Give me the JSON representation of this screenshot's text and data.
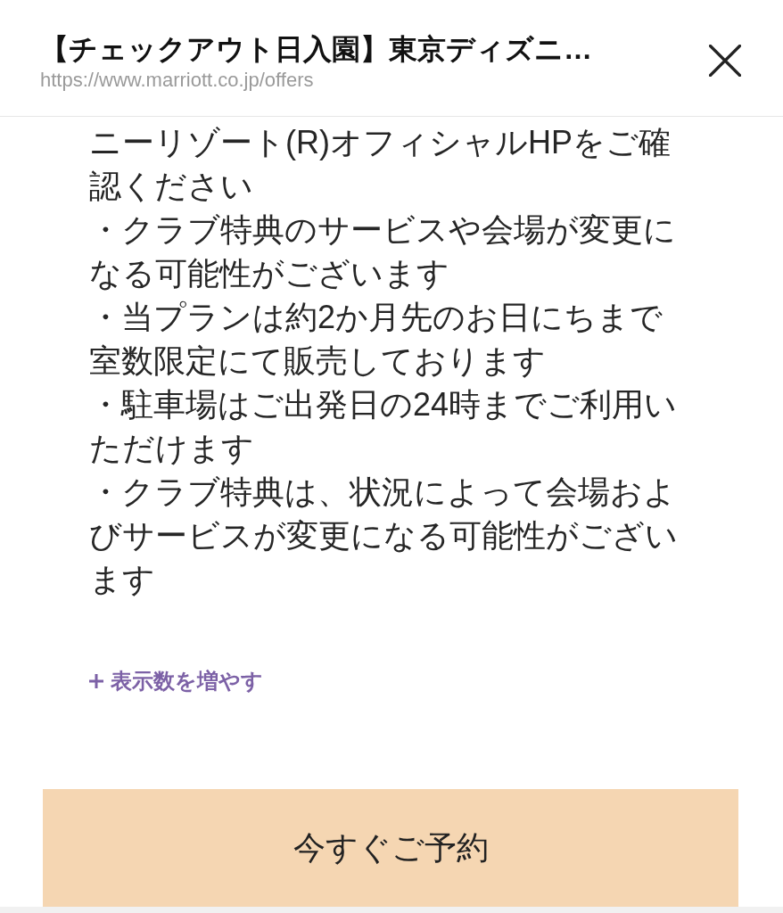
{
  "header": {
    "title": "【チェックアウト日入園】東京ディズニ…",
    "url": "https://www.marriott.co.jp/offers"
  },
  "notes": [
    "ニーリゾート(R)オフィシャルHPをご確認ください",
    "・クラブ特典のサービスや会場が変更になる可能性がございます",
    "・当プランは約2か月先のお日にちまで室数限定にて販売しております",
    "・駐車場はご出発日の24時までご利用いただけます",
    "・クラブ特典は、状況によって会場およびサービスが変更になる可能性がございます"
  ],
  "show_more": {
    "label": "表示数を増やす"
  },
  "reserve_button": {
    "label": "今すぐご予約"
  }
}
